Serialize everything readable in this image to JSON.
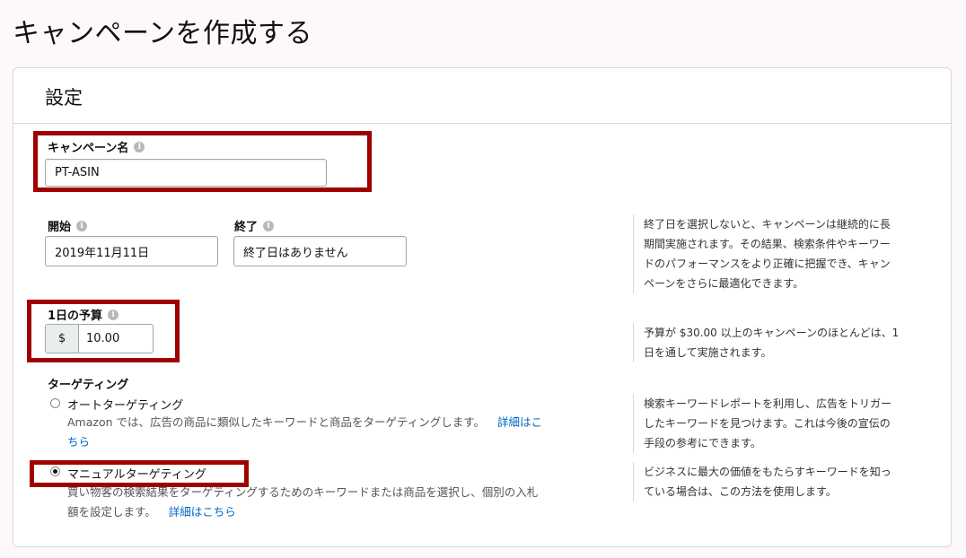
{
  "page": {
    "title": "キャンペーンを作成する"
  },
  "settings": {
    "section_title": "設定",
    "campaign_name": {
      "label": "キャンペーン名",
      "value": "PT-ASIN"
    },
    "start": {
      "label": "開始",
      "value": "2019年11月11日"
    },
    "end": {
      "label": "終了",
      "value": "終了日はありません"
    },
    "dates_help": [
      "終了日を選択しないと、キャンペーンは継続的に長",
      "期間実施されます。その結果、検索条件やキーワー",
      "ドのパフォーマンスをより正確に把握でき、キャン",
      "ペーンをさらに最適化できます。"
    ],
    "budget": {
      "label": "1日の予算",
      "currency": "$",
      "value": "10.00"
    },
    "budget_help": [
      "予算が $30.00 以上のキャンペーンのほとんどは、1",
      "日を通して実施されます。"
    ],
    "targeting": {
      "heading": "ターゲティング",
      "auto": {
        "label": "オートターゲティング",
        "desc_1": "Amazon では、広告の商品に類似したキーワードと商品をターゲティングします。",
        "link_1": "詳細はこ",
        "link_2": "ちら",
        "help": [
          "検索キーワードレポートを利用し、広告をトリガー",
          "したキーワードを見つけます。これは今後の宣伝の",
          "手段の参考にできます。"
        ]
      },
      "manual": {
        "label": "マニュアルターゲティング",
        "desc_1": "買い物客の検索結果をターゲティングするためのキーワードまたは商品を選択し、個別の入札",
        "desc_2": "額を設定します。",
        "link": "詳細はこちら",
        "help": [
          "ビジネスに最大の価値をもたらすキーワードを知っ",
          "ている場合は、この方法を使用します。"
        ]
      },
      "selected": "manual"
    }
  },
  "colors": {
    "highlight": "#a00000",
    "link": "#0066c0"
  }
}
